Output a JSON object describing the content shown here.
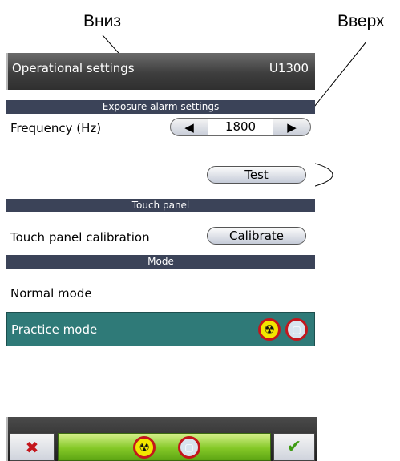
{
  "annotations": {
    "down": "Вниз",
    "up": "Вверх"
  },
  "titlebar": {
    "title": "Operational settings",
    "model": "U1300"
  },
  "sections": {
    "exposure_alarm": "Exposure alarm settings",
    "touch_panel": "Touch panel",
    "mode": "Mode"
  },
  "frequency": {
    "label": "Frequency (Hz)",
    "value": "1800"
  },
  "test_button": "Test",
  "touch_calibration": {
    "label": "Touch panel calibration",
    "button": "Calibrate"
  },
  "modes": {
    "normal": "Normal mode",
    "practice": "Practice mode"
  },
  "icons": {
    "radiation": "radiation-prohibited-icon",
    "screen": "screen-prohibited-icon",
    "cancel": "cancel-icon",
    "confirm": "checkmark-icon"
  },
  "colors": {
    "section_bar": "#3b4358",
    "practice_bg": "#2f7a78",
    "status_green": "#84c827",
    "prohibit_red": "#c4161c"
  }
}
